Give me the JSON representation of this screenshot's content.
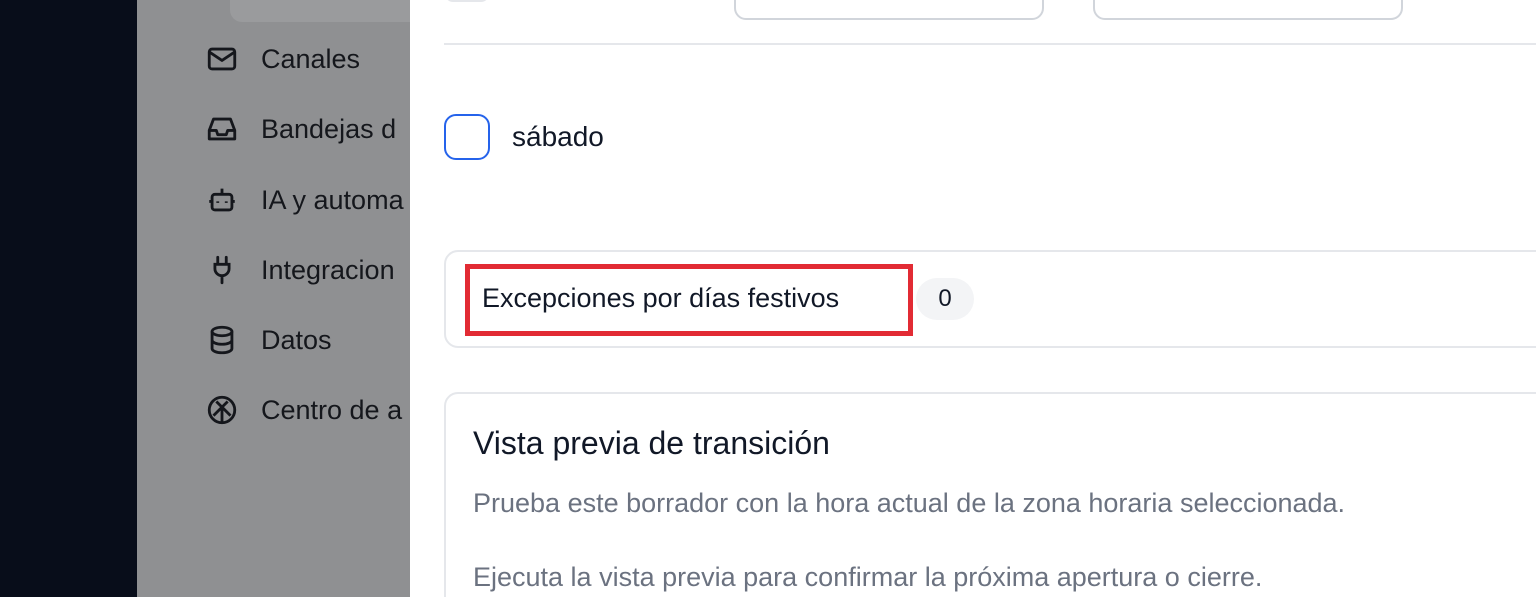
{
  "sidebar": {
    "items": [
      {
        "label": "Canales",
        "icon": "mail-icon"
      },
      {
        "label": "Bandejas d",
        "icon": "inbox-icon"
      },
      {
        "label": "IA y automa",
        "icon": "bot-icon"
      },
      {
        "label": "Integracion",
        "icon": "plug-icon"
      },
      {
        "label": "Datos",
        "icon": "database-icon"
      },
      {
        "label": "Centro de a",
        "icon": "help-center-icon"
      }
    ]
  },
  "schedule": {
    "day_label": "sábado"
  },
  "holidays": {
    "title": "Excepciones por días festivos",
    "count": "0"
  },
  "preview": {
    "title": "Vista previa de transición",
    "description": "Prueba este borrador con la hora actual de la zona horaria seleccionada.",
    "note": "Ejecuta la vista previa para confirmar la próxima apertura o cierre."
  },
  "colors": {
    "highlight_border": "#e22b34",
    "checkbox_border": "#2563eb",
    "rail": "#080d1a",
    "sidebar_overlay": "#8f9092"
  }
}
